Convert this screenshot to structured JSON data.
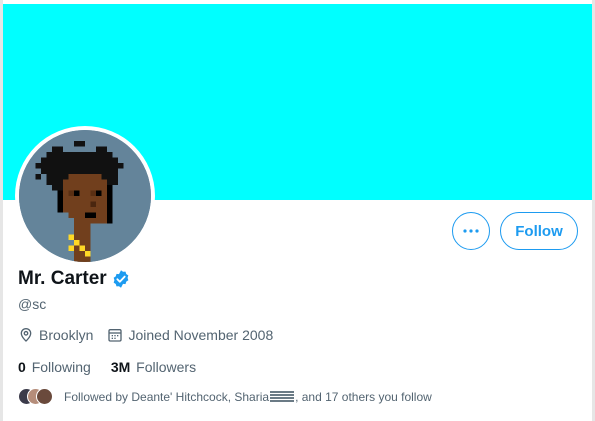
{
  "profile": {
    "name": "Mr. Carter",
    "handle": "@sc",
    "location": "Brooklyn",
    "joined": "Joined November 2008",
    "verified": true
  },
  "stats": {
    "following_count": "0",
    "following_label": "Following",
    "followers_count": "3M",
    "followers_label": "Followers"
  },
  "followed_by": {
    "prefix": "Followed by Deante' Hitchcock, Sharia",
    "suffix": ", and 17 others you follow"
  },
  "actions": {
    "follow_label": "Follow",
    "more_icon": "more-horizontal-icon"
  },
  "colors": {
    "banner": "#00ffff",
    "accent": "#1d9bf0",
    "text_primary": "#0f1419",
    "text_secondary": "#536471"
  }
}
